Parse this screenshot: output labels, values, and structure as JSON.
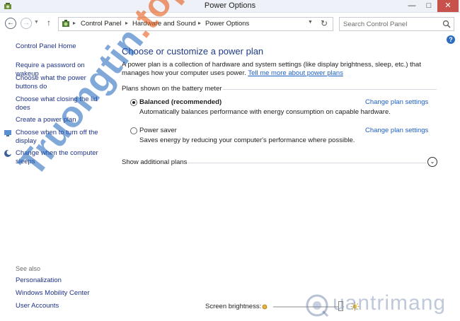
{
  "window": {
    "title": "Power Options"
  },
  "breadcrumb": [
    "Control Panel",
    "Hardware and Sound",
    "Power Options"
  ],
  "search": {
    "placeholder": "Search Control Panel"
  },
  "sidebar": {
    "home": "Control Panel Home",
    "items": [
      "Require a password on wakeup",
      "Choose what the power buttons do",
      "Choose what closing the lid does",
      "Create a power plan",
      "Choose when to turn off the display",
      "Change when the computer sleeps"
    ],
    "see_also_title": "See also",
    "see_also": [
      "Personalization",
      "Windows Mobility Center",
      "User Accounts"
    ]
  },
  "main": {
    "heading": "Choose or customize a power plan",
    "description": "A power plan is a collection of hardware and system settings (like display brightness, sleep, etc.) that manages how your computer uses power. ",
    "description_link": "Tell me more about power plans",
    "section_label": "Plans shown on the battery meter",
    "plans": [
      {
        "name": "Balanced (recommended)",
        "selected": true,
        "description": "Automatically balances performance with energy consumption on capable hardware.",
        "link": "Change plan settings"
      },
      {
        "name": "Power saver",
        "selected": false,
        "description": "Saves energy by reducing your computer's performance where possible.",
        "link": "Change plan settings"
      }
    ],
    "show_more": "Show additional plans"
  },
  "brightness": {
    "label": "Screen brightness:",
    "level_percent": 95
  },
  "watermark": {
    "diagonal_part1": "Truongtin",
    "diagonal_part2": ".top",
    "brand": "uantrimang"
  },
  "colors": {
    "link": "#1e3287",
    "heading": "#1f3b8a",
    "accent_link": "#1c5fc5",
    "close_button": "#c7514b"
  }
}
